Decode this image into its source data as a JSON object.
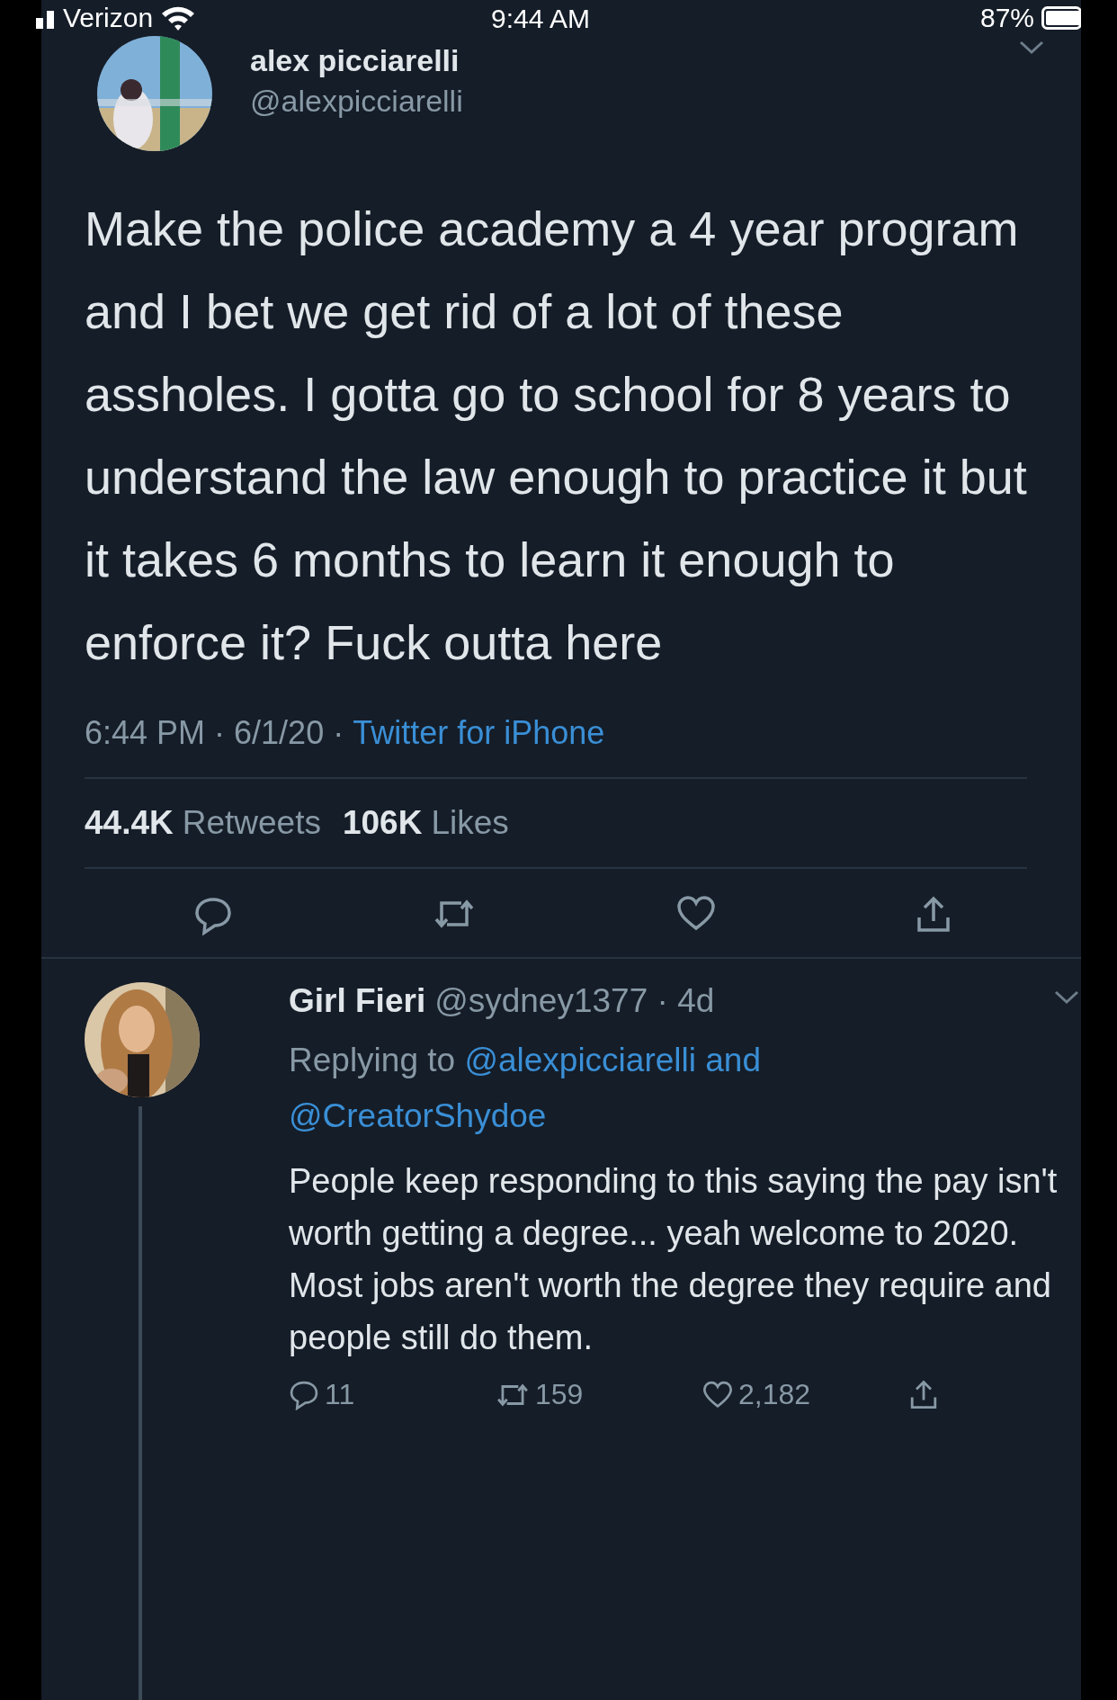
{
  "status_bar": {
    "carrier": "Verizon",
    "time": "9:44 AM",
    "battery": "87%"
  },
  "tweet": {
    "name": "alex picciarelli",
    "handle": "@alexpicciarelli",
    "text": "Make the police academy a 4 year program and I bet we get rid of a lot of these assholes. I gotta go to school for 8 years to understand the law enough to practice it but it takes 6 months to learn it enough to enforce it? Fuck outta here",
    "timestamp": "6:44 PM · 6/1/20 ·",
    "source": "Twitter for iPhone",
    "stats": [
      {
        "count": "44.4K",
        "label": "Retweets"
      },
      {
        "count": "106K",
        "label": "Likes"
      }
    ],
    "actions": [
      {
        "kind": "reply"
      },
      {
        "kind": "retweet"
      },
      {
        "kind": "like"
      },
      {
        "kind": "share"
      }
    ]
  },
  "reply": {
    "name": "Girl Fieri",
    "handle_time": "@sydney1377 · 4d",
    "replying_label": "Replying to",
    "mentions": [
      "@alexpicciarelli",
      "@CreatorShydoe"
    ],
    "joiner": "and",
    "text": "People keep responding to this saying the pay isn't worth getting a degree... yeah welcome to 2020. Most jobs aren't worth the degree they require and people still do them.",
    "actions": [
      {
        "kind": "reply",
        "count": "11"
      },
      {
        "kind": "retweet",
        "count": "159"
      },
      {
        "kind": "like",
        "count": "2,182"
      },
      {
        "kind": "share"
      }
    ]
  }
}
